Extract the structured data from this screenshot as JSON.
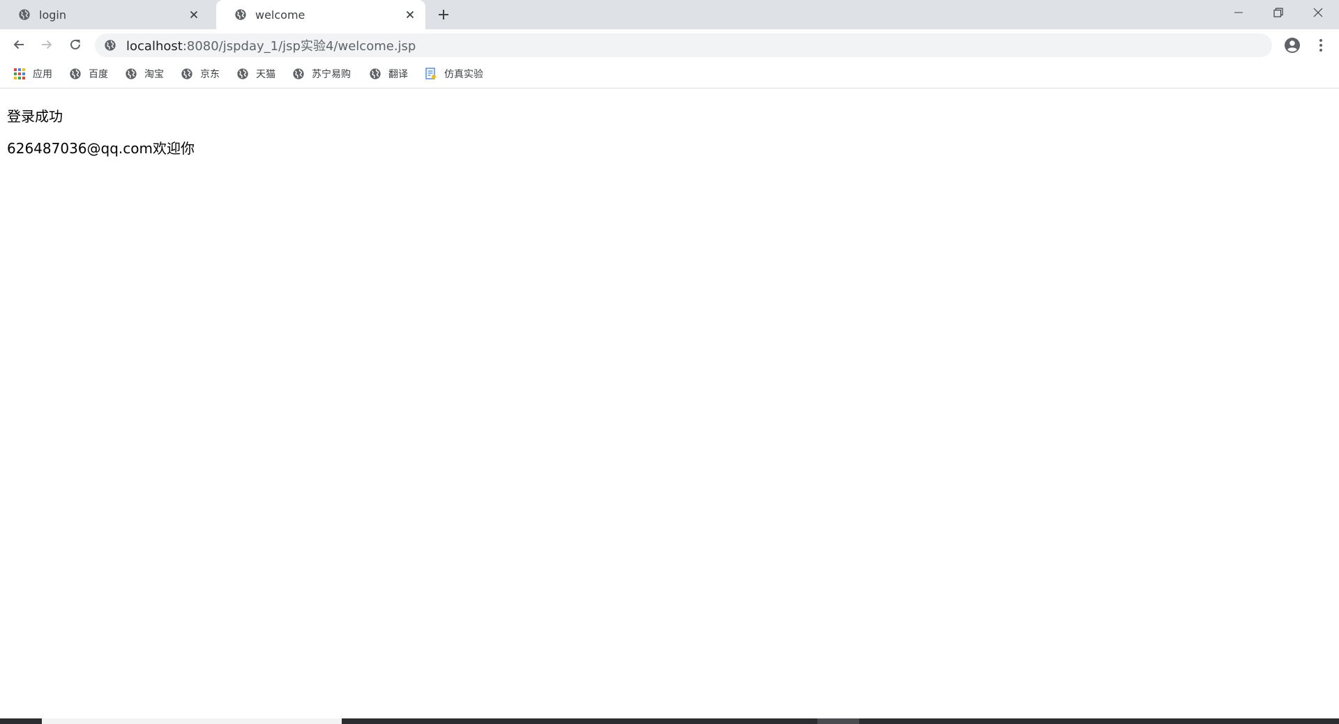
{
  "tabs": [
    {
      "title": "login",
      "active": false
    },
    {
      "title": "welcome",
      "active": true
    }
  ],
  "address_bar": {
    "host": "localhost",
    "path": ":8080/jspday_1/jsp实验4/welcome.jsp"
  },
  "bookmarks": [
    {
      "label": "应用",
      "icon": "apps-grid-icon"
    },
    {
      "label": "百度",
      "icon": "globe-icon"
    },
    {
      "label": "淘宝",
      "icon": "globe-icon"
    },
    {
      "label": "京东",
      "icon": "globe-icon"
    },
    {
      "label": "天猫",
      "icon": "globe-icon"
    },
    {
      "label": "苏宁易购",
      "icon": "globe-icon"
    },
    {
      "label": "翻译",
      "icon": "globe-icon"
    },
    {
      "label": "仿真实验",
      "icon": "document-icon"
    }
  ],
  "page": {
    "message_line1": "登录成功",
    "message_line2": "626487036@qq.com欢迎你"
  },
  "colors": {
    "tabstrip_bg": "#dee1e6",
    "omnibox_bg": "#f1f3f4",
    "icon_gray": "#5f6368"
  }
}
